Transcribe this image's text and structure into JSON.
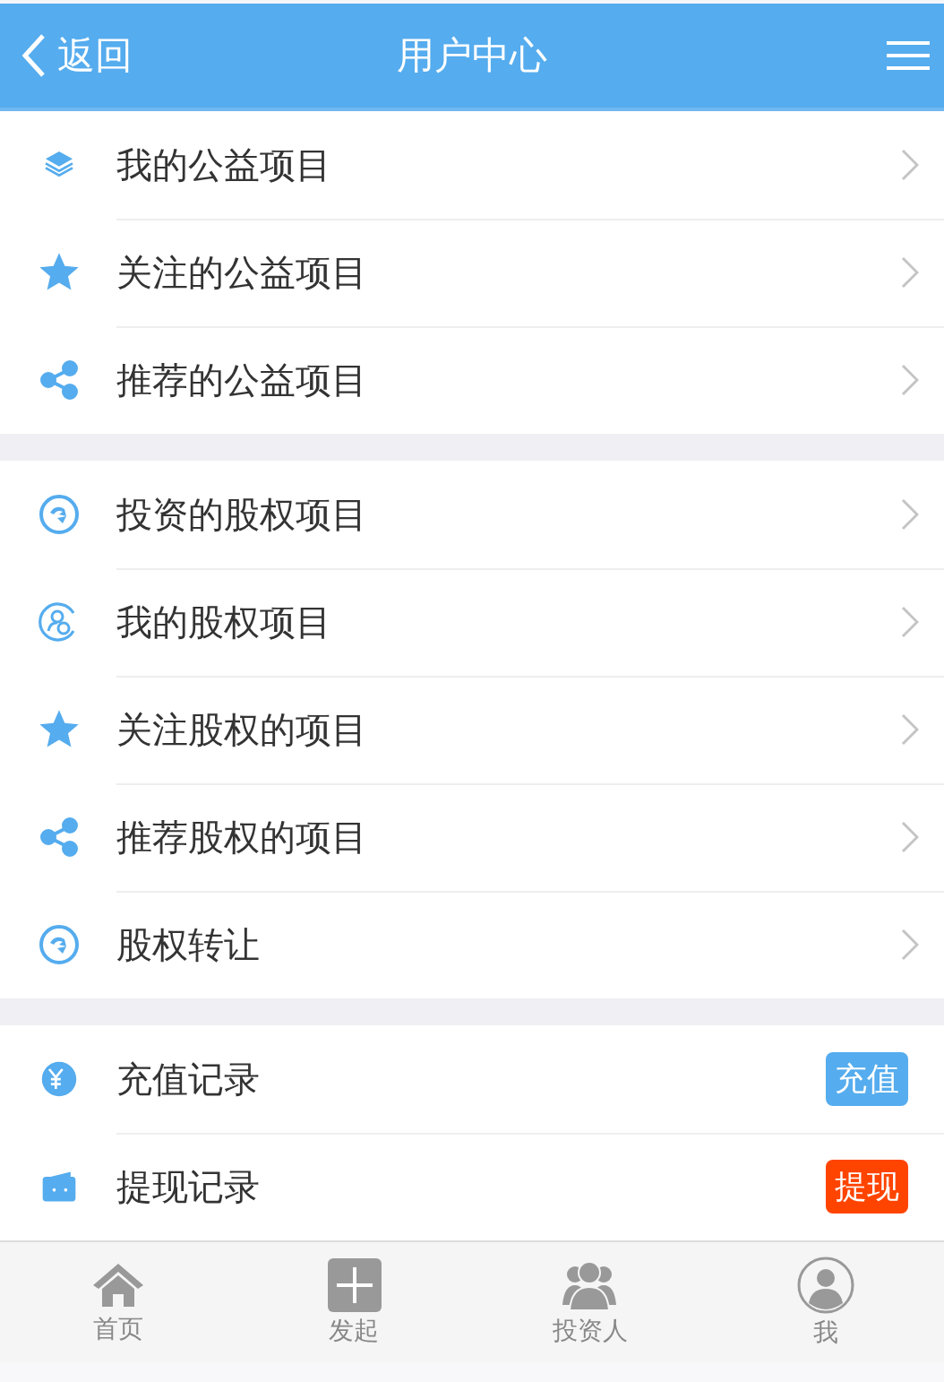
{
  "header": {
    "back": "返回",
    "title": "用户中心"
  },
  "groups": [
    {
      "items": [
        {
          "kind": "layers",
          "label": "我的公益项目"
        },
        {
          "kind": "star",
          "label": "关注的公益项目"
        },
        {
          "kind": "share",
          "label": "推荐的公益项目"
        }
      ]
    },
    {
      "items": [
        {
          "kind": "circle-arrow",
          "label": "投资的股权项目"
        },
        {
          "kind": "user-circle",
          "label": "我的股权项目"
        },
        {
          "kind": "star",
          "label": "关注股权的项目"
        },
        {
          "kind": "share",
          "label": "推荐股权的项目"
        },
        {
          "kind": "circle-arrow",
          "label": "股权转让"
        }
      ]
    },
    {
      "items": [
        {
          "kind": "yen",
          "label": "充值记录",
          "badge": {
            "label": "充值",
            "color": "#55acee"
          }
        },
        {
          "kind": "wallet",
          "label": "提现记录",
          "badge": {
            "label": "提现",
            "color": "#ff4400"
          }
        }
      ]
    }
  ],
  "tabbar": [
    {
      "kind": "home",
      "label": "首页"
    },
    {
      "kind": "plus",
      "label": "发起"
    },
    {
      "kind": "people",
      "label": "投资人"
    },
    {
      "kind": "person",
      "label": "我"
    }
  ]
}
